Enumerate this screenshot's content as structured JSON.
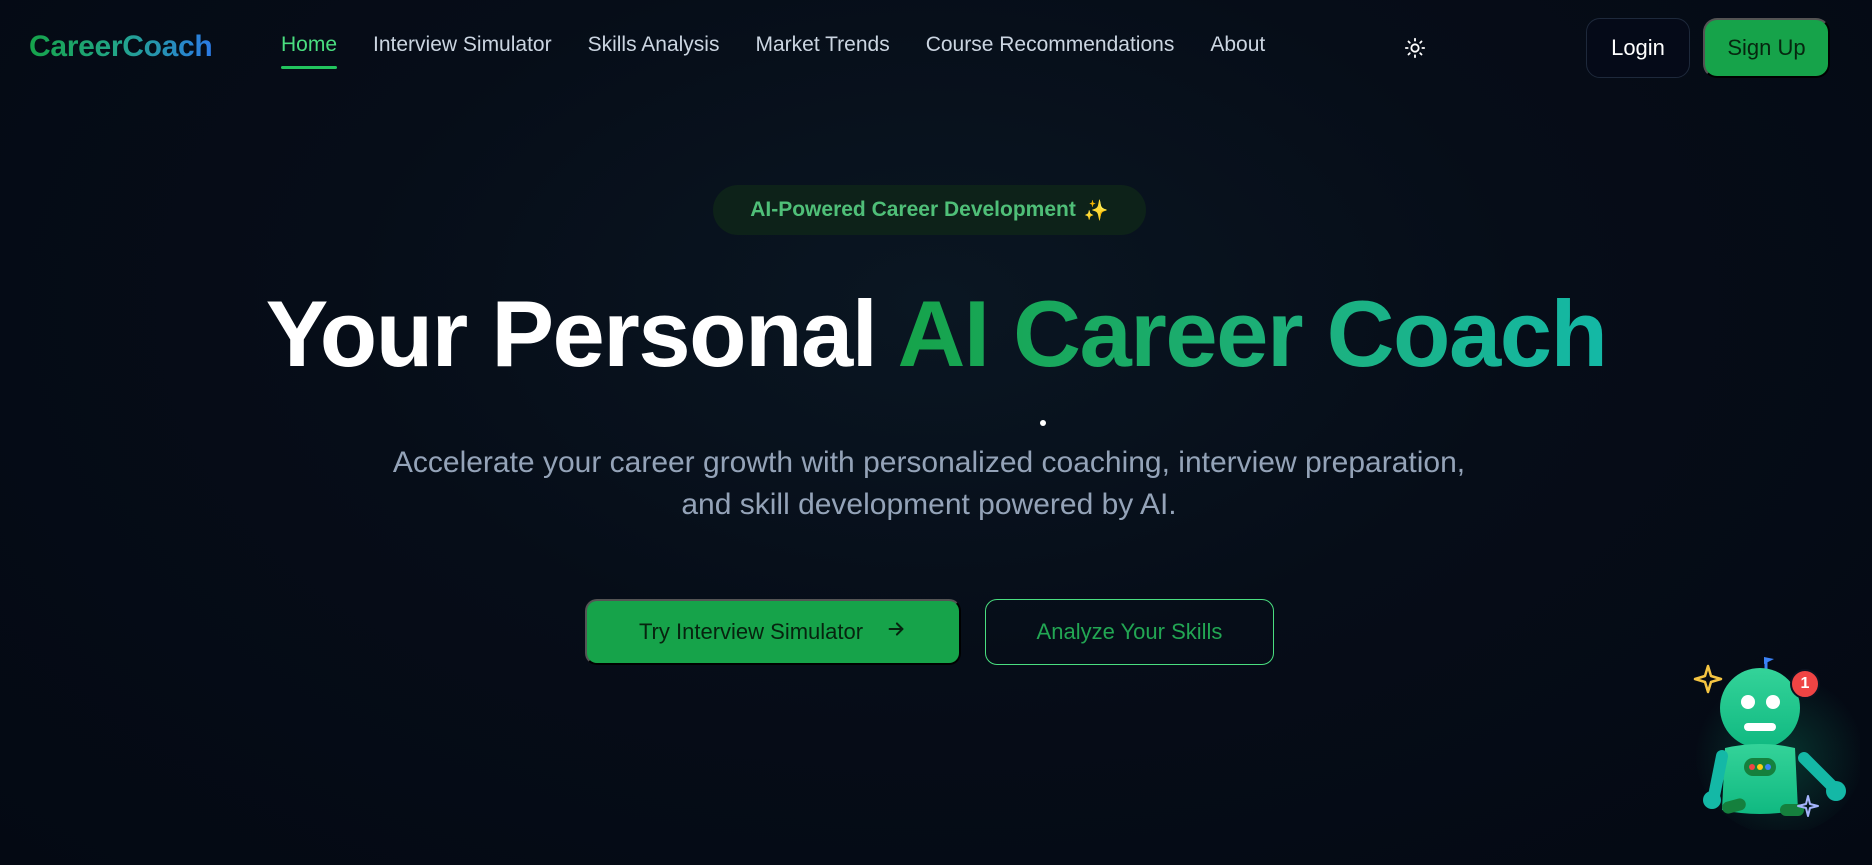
{
  "brand": {
    "logo": "CareerCoach"
  },
  "nav": {
    "items": [
      {
        "label": "Home",
        "active": true
      },
      {
        "label": "Interview Simulator"
      },
      {
        "label": "Skills Analysis"
      },
      {
        "label": "Market Trends"
      },
      {
        "label": "Course Recommendations"
      },
      {
        "label": "About"
      }
    ],
    "theme_icon": "sun-icon",
    "login_label": "Login",
    "signup_label": "Sign Up"
  },
  "hero": {
    "badge": "AI-Powered Career Development",
    "badge_emoji": "✨",
    "headline_white": "Your Personal",
    "headline_gradient": "AI Career Coach",
    "subtitle": "Accelerate your career growth with personalized coaching, interview preparation, and skill development powered by AI.",
    "primary_cta": "Try Interview Simulator",
    "primary_cta_icon": "arrow-right-icon",
    "secondary_cta": "Analyze Your Skills"
  },
  "assistant": {
    "icon": "robot-assistant-icon",
    "notification_count": "1"
  },
  "colors": {
    "background": "#050b16",
    "accent": "#16a34a",
    "accent_light": "#4ade80",
    "teal": "#14b8a6",
    "text_muted": "#94a3b8",
    "notification": "#ef4444"
  }
}
